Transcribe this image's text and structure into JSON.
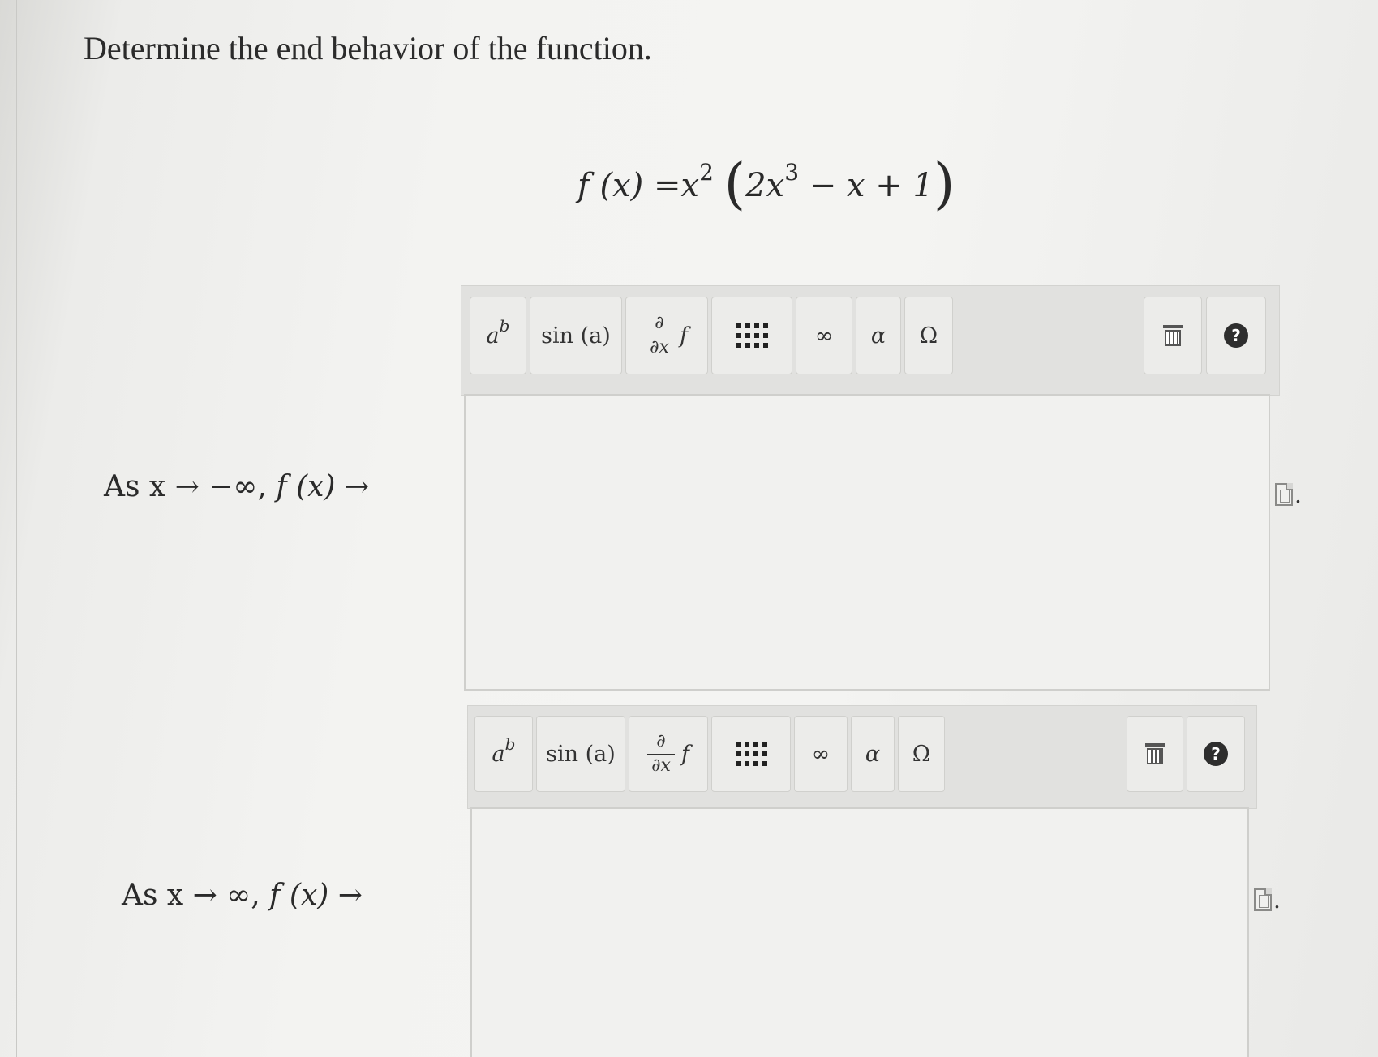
{
  "question": {
    "prompt": "Determine the end behavior of the function."
  },
  "function": {
    "lhs": "f (x) =",
    "base": "x",
    "exp": "2",
    "inner_coef": "2x",
    "inner_exp": "3",
    "inner_rest": "− x + 1"
  },
  "rows": [
    {
      "label_prefix": "As x → −∞, ",
      "label_f": "f (x) →",
      "trailing": "."
    },
    {
      "label_prefix": "As x → ∞, ",
      "label_f": "f (x) →",
      "trailing": "."
    }
  ],
  "toolbar": {
    "power_base": "a",
    "power_exp": "b",
    "trig": "sin (a)",
    "partial_top": "∂",
    "partial_bottom": "∂x",
    "partial_f": "f",
    "infinity": "∞",
    "alpha": "α",
    "omega": "Ω",
    "help": "?"
  },
  "icons": [
    "matrix-icon",
    "trash-icon",
    "help-icon",
    "document-icon"
  ]
}
